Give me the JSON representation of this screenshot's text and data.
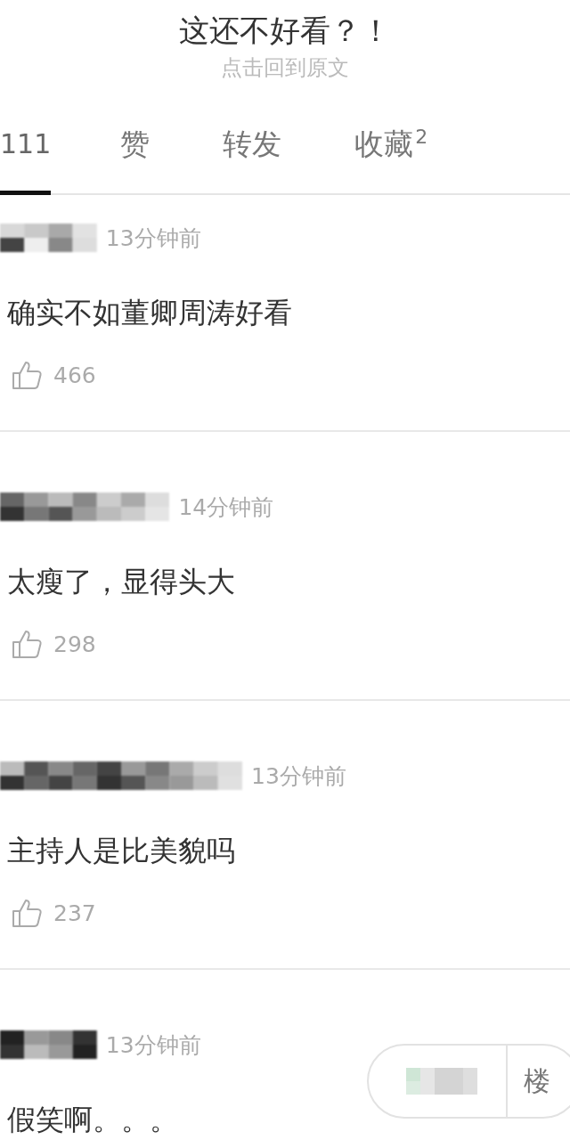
{
  "header": {
    "title": "这还不好看？！",
    "subtitle": "点击回到原文"
  },
  "tabs": [
    {
      "label": "111",
      "selected": true
    },
    {
      "label": "赞",
      "selected": false
    },
    {
      "label": "转发",
      "selected": false
    },
    {
      "label": "收藏$^{2}$",
      "selected": false
    }
  ],
  "comments": [
    {
      "time": "13分钟前",
      "text": "确实不如董卿周涛好看",
      "likes": "466"
    },
    {
      "time": "14分钟前",
      "text": "太瘦了，显得头大",
      "likes": "298"
    },
    {
      "time": "13分钟前",
      "text": "主持人是比美貌吗",
      "likes": "237"
    },
    {
      "time": "13分钟前",
      "text": "假笑啊。。。"
    }
  ],
  "floating_bar": {
    "label": "楼"
  }
}
